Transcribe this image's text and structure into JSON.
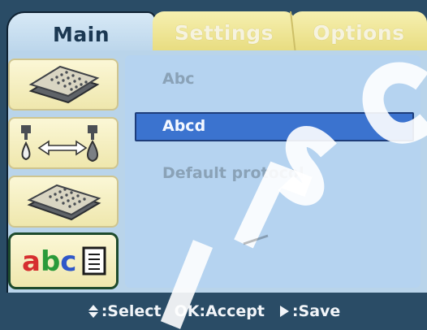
{
  "tabs": [
    {
      "label": "Main",
      "state": "active"
    },
    {
      "label": "Settings",
      "state": "inactive"
    },
    {
      "label": "Options",
      "state": "inactive"
    }
  ],
  "icon_buttons": [
    {
      "icon": "microplate-stack-icon"
    },
    {
      "icon": "dispense-transfer-icon"
    },
    {
      "icon": "microplate-icon"
    },
    {
      "icon": "abc-label-icon",
      "text": "abc",
      "selected": true
    }
  ],
  "list": {
    "items": [
      {
        "label": "Abc",
        "selected": false
      },
      {
        "label": "Abcd",
        "selected": true
      },
      {
        "label": "Default protocol",
        "selected": false
      }
    ]
  },
  "footer": {
    "select": ":Select",
    "accept": "OK:Accept",
    "save": ":Save"
  },
  "colors": {
    "background": "#2a4c66",
    "panel": "#b5d3f0",
    "selection": "#3b73cf",
    "tab_inactive": "#efe7ad"
  }
}
